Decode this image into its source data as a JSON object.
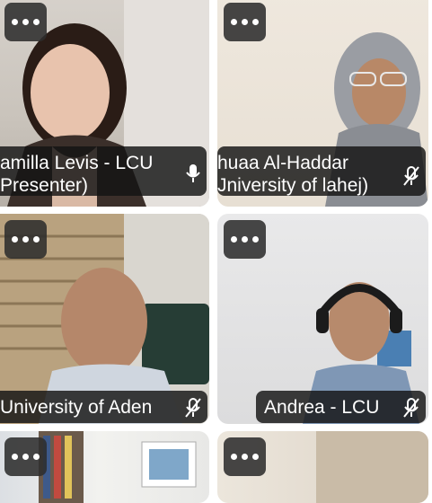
{
  "tiles": [
    {
      "id": "t1",
      "name_line1": "amilla Levis - LCU",
      "name_line2": "Presenter)",
      "mic": "mic-on-icon"
    },
    {
      "id": "t2",
      "name_line1": "huaa Al-Haddar",
      "name_line2": "Jniversity of lahej)",
      "mic": "mic-muted-icon"
    },
    {
      "id": "t3",
      "name_line1": "University of Aden",
      "mic": "mic-muted-icon"
    },
    {
      "id": "t4",
      "name_line1": "Andrea - LCU",
      "mic": "mic-muted-icon"
    },
    {
      "id": "t5"
    },
    {
      "id": "t6"
    }
  ],
  "icons": {
    "more": "more-options-icon"
  }
}
